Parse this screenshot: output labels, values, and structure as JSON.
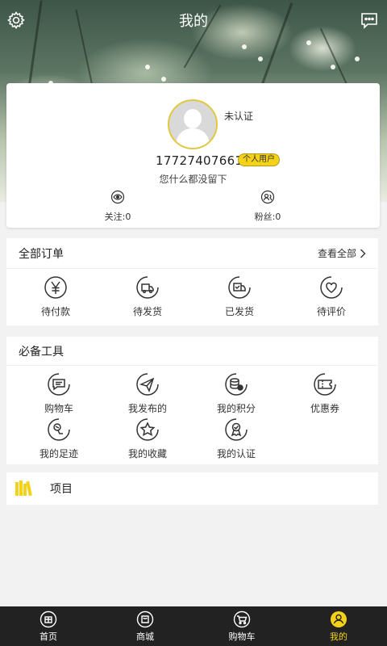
{
  "header": {
    "title": "我的"
  },
  "profile": {
    "verify_status": "未认证",
    "phone": "17727407661",
    "user_type": "个人用户",
    "bio": "您什么都没留下",
    "following_label": "关注:0",
    "followers_label": "粉丝:0"
  },
  "orders": {
    "title": "全部订单",
    "view_all": "查看全部",
    "items": [
      {
        "label": "待付款",
        "icon": "yen-icon"
      },
      {
        "label": "待发货",
        "icon": "truck-icon"
      },
      {
        "label": "已发货",
        "icon": "shipped-icon"
      },
      {
        "label": "待评价",
        "icon": "heart-icon"
      }
    ]
  },
  "tools": {
    "title": "必备工具",
    "items": [
      {
        "label": "购物车",
        "icon": "chat-list-icon"
      },
      {
        "label": "我发布的",
        "icon": "paper-plane-icon"
      },
      {
        "label": "我的积分",
        "icon": "coins-icon"
      },
      {
        "label": "优惠券",
        "icon": "coupon-icon"
      },
      {
        "label": "我的足迹",
        "icon": "footprint-icon"
      },
      {
        "label": "我的收藏",
        "icon": "star-icon"
      },
      {
        "label": "我的认证",
        "icon": "verify-icon"
      }
    ]
  },
  "project": {
    "label": "项目"
  },
  "tabbar": {
    "items": [
      {
        "label": "首页",
        "icon": "home-icon"
      },
      {
        "label": "商城",
        "icon": "store-icon"
      },
      {
        "label": "购物车",
        "icon": "cart-icon"
      },
      {
        "label": "我的",
        "icon": "user-icon"
      }
    ],
    "active": 3
  },
  "colors": {
    "accent": "#f5d21a",
    "tabbar_bg": "#222222",
    "avatar_ring": "#e2c840"
  }
}
